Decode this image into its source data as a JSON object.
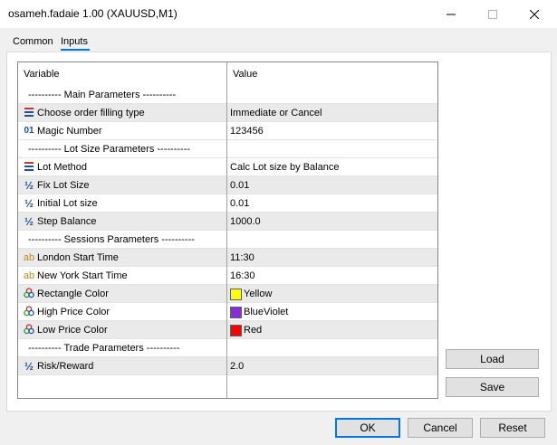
{
  "window": {
    "title": "osameh.fadaie 1.00 (XAUUSD,M1)",
    "controls": {
      "minimize": "minimize-icon",
      "maximize": "maximize-icon",
      "close": "close-icon"
    }
  },
  "tabs": [
    {
      "label": "Common",
      "active": false
    },
    {
      "label": "Inputs",
      "active": true
    }
  ],
  "grid": {
    "headers": {
      "variable": "Variable",
      "value": "Value"
    },
    "rows": [
      {
        "kind": "separator",
        "variable": "---------- Main Parameters ----------",
        "value": ""
      },
      {
        "kind": "enum",
        "icon": "enum-icon",
        "variable": "Choose order filling type",
        "value": "Immediate or Cancel"
      },
      {
        "kind": "int",
        "icon": "integer-icon",
        "variable": "Magic Number",
        "value": "123456"
      },
      {
        "kind": "separator",
        "variable": "---------- Lot Size Parameters ----------",
        "value": ""
      },
      {
        "kind": "enum",
        "icon": "enum-icon",
        "variable": "Lot Method",
        "value": "Calc Lot size by Balance"
      },
      {
        "kind": "double",
        "icon": "fraction-icon",
        "variable": "Fix Lot Size",
        "value": "0.01"
      },
      {
        "kind": "double",
        "icon": "fraction-icon",
        "variable": "Initial Lot size",
        "value": "0.01"
      },
      {
        "kind": "double",
        "icon": "fraction-icon",
        "variable": "Step Balance",
        "value": "1000.0"
      },
      {
        "kind": "separator",
        "variable": "---------- Sessions Parameters ----------",
        "value": ""
      },
      {
        "kind": "string",
        "icon": "text-icon",
        "variable": "London Start Time",
        "value": "11:30"
      },
      {
        "kind": "string",
        "icon": "text-icon",
        "variable": "New York Start Time",
        "value": "16:30"
      },
      {
        "kind": "color",
        "icon": "color-icon",
        "variable": "Rectangle Color",
        "value": "Yellow",
        "color": "#ffff00"
      },
      {
        "kind": "color",
        "icon": "color-icon",
        "variable": "High Price Color",
        "value": "BlueViolet",
        "color": "#8a2be2"
      },
      {
        "kind": "color",
        "icon": "color-icon",
        "variable": "Low Price Color",
        "value": "Red",
        "color": "#ff0000"
      },
      {
        "kind": "separator",
        "variable": "---------- Trade Parameters ----------",
        "value": ""
      },
      {
        "kind": "double",
        "icon": "fraction-icon",
        "variable": "Risk/Reward",
        "value": "2.0"
      }
    ]
  },
  "side_buttons": {
    "load": "Load",
    "save": "Save"
  },
  "footer_buttons": {
    "ok": "OK",
    "cancel": "Cancel",
    "reset": "Reset"
  },
  "colors": {
    "accent": "#0078d7"
  }
}
